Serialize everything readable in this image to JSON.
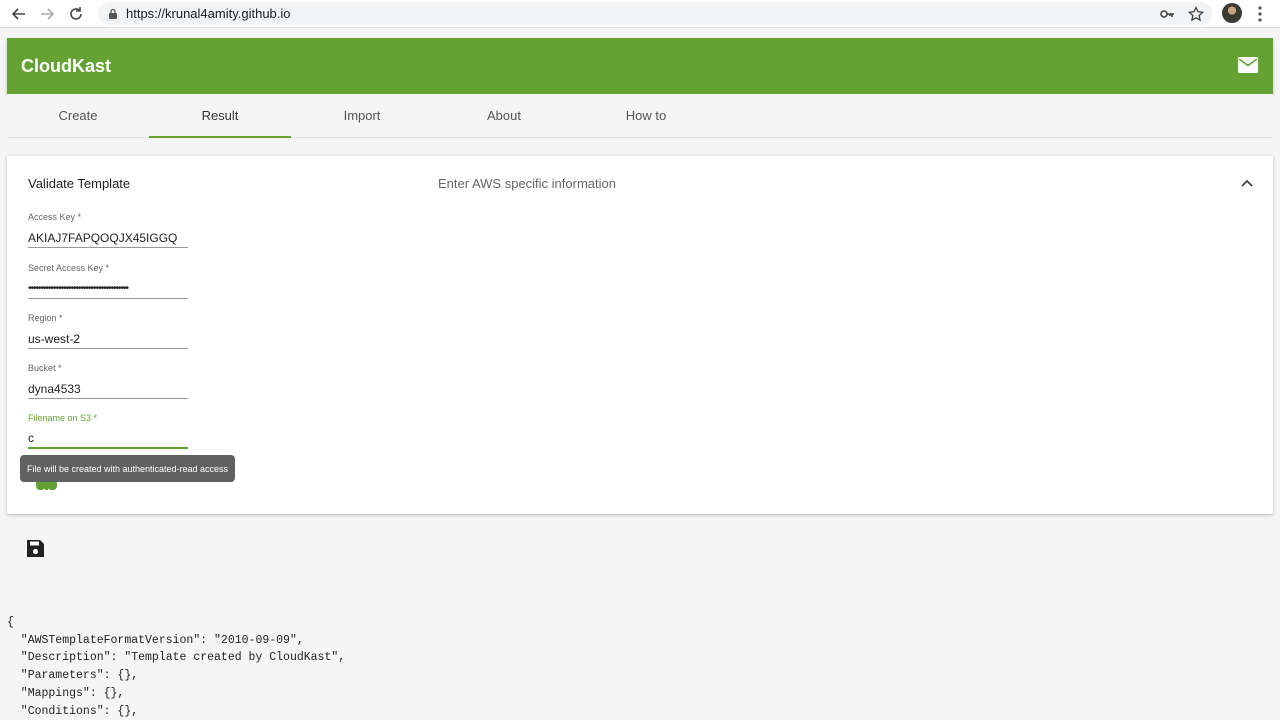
{
  "browser": {
    "url": "https://krunal4amity.github.io",
    "icons": [
      "back-arrow-icon",
      "forward-arrow-icon",
      "reload-icon",
      "lock-icon",
      "key-icon",
      "star-icon",
      "profile-avatar",
      "menu-dots-icon"
    ]
  },
  "app": {
    "title": "CloudKast",
    "brand_color": "#64a233",
    "mail_icon": "mail-icon"
  },
  "tabs": [
    {
      "label": "Create",
      "active": false
    },
    {
      "label": "Result",
      "active": true
    },
    {
      "label": "Import",
      "active": false
    },
    {
      "label": "About",
      "active": false
    },
    {
      "label": "How to",
      "active": false
    }
  ],
  "panel": {
    "title": "Validate Template",
    "subtitle": "Enter AWS specific information",
    "fields": [
      {
        "label": "Access Key *",
        "value": "AKIAJ7FAPQOQJX45IGGQ"
      },
      {
        "label": "Secret Access Key *",
        "value": "••••••••••••••••••••••••••••••••••••••••"
      },
      {
        "label": "Region *",
        "value": "us-west-2"
      },
      {
        "label": "Bucket *",
        "value": "dyna4533"
      },
      {
        "label": "Filename on S3 *",
        "value": "c"
      }
    ],
    "tooltip": "File will be created with authenticated-read access"
  },
  "code_lines": [
    "{",
    "  \"AWSTemplateFormatVersion\": \"2010-09-09\",",
    "  \"Description\": \"Template created by CloudKast\",",
    "  \"Parameters\": {},",
    "  \"Mappings\": {},",
    "  \"Conditions\": {},"
  ]
}
